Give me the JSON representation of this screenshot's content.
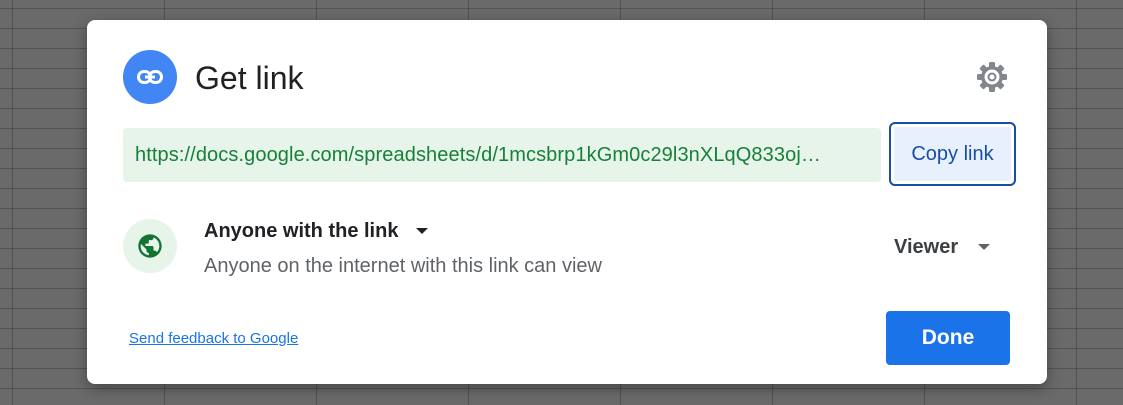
{
  "dialog": {
    "title": "Get link",
    "header_icon": "link-icon",
    "settings_icon": "gear-icon"
  },
  "link": {
    "url": "https://docs.google.com/spreadsheets/d/1mcsbrp1kGm0c29l3nXLqQ833oj…",
    "copy_label": "Copy link"
  },
  "access": {
    "icon": "globe-icon",
    "label": "Anyone with the link",
    "description": "Anyone on the internet with this link can view",
    "role": "Viewer"
  },
  "footer": {
    "feedback_link": "Send feedback to Google",
    "done_label": "Done"
  },
  "colors": {
    "primary_blue": "#1a73e8",
    "header_badge": "#4285f4",
    "link_green": "#188038",
    "link_bg": "#e6f4ea",
    "copy_border": "#174ea6"
  }
}
